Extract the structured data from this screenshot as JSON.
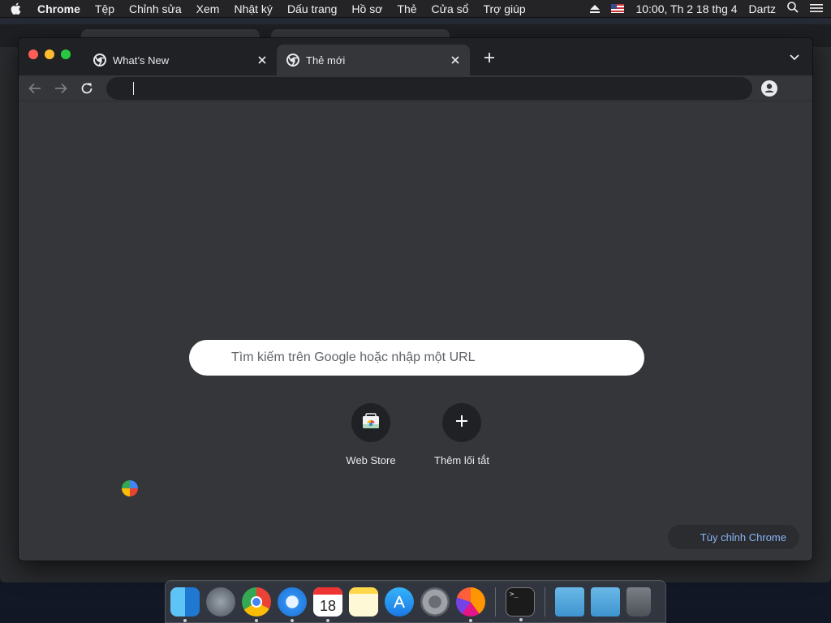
{
  "menubar": {
    "app_name": "Chrome",
    "items": [
      "Tệp",
      "Chỉnh sửa",
      "Xem",
      "Nhật ký",
      "Dấu trang",
      "Hồ sơ",
      "Thẻ",
      "Cửa sổ",
      "Trợ giúp"
    ],
    "clock": "10:00, Th 2 18 thg 4",
    "user": "Dartz"
  },
  "tabs": [
    {
      "title": "What’s New",
      "active": false
    },
    {
      "title": "Thẻ mới",
      "active": true
    }
  ],
  "omnibox": {
    "value": ""
  },
  "ntp": {
    "search_placeholder": "Tìm kiếm trên Google hoặc nhập một URL",
    "shortcuts": [
      {
        "label": "Web Store",
        "icon": "web-store-icon"
      },
      {
        "label": "Thêm lối tắt",
        "icon": "plus-icon"
      }
    ],
    "customize_label": "Tùy chỉnh Chrome"
  },
  "dock": {
    "apps": [
      "finder",
      "launchpad",
      "chrome",
      "safari",
      "calendar",
      "notes",
      "app-store",
      "system-preferences",
      "firefox",
      "terminal",
      "applications-folder",
      "downloads-folder",
      "trash"
    ],
    "calendar_day": "18"
  },
  "colors": {
    "tabstrip": "#202124",
    "toolbar": "#35363a",
    "link": "#8ab4f8"
  }
}
